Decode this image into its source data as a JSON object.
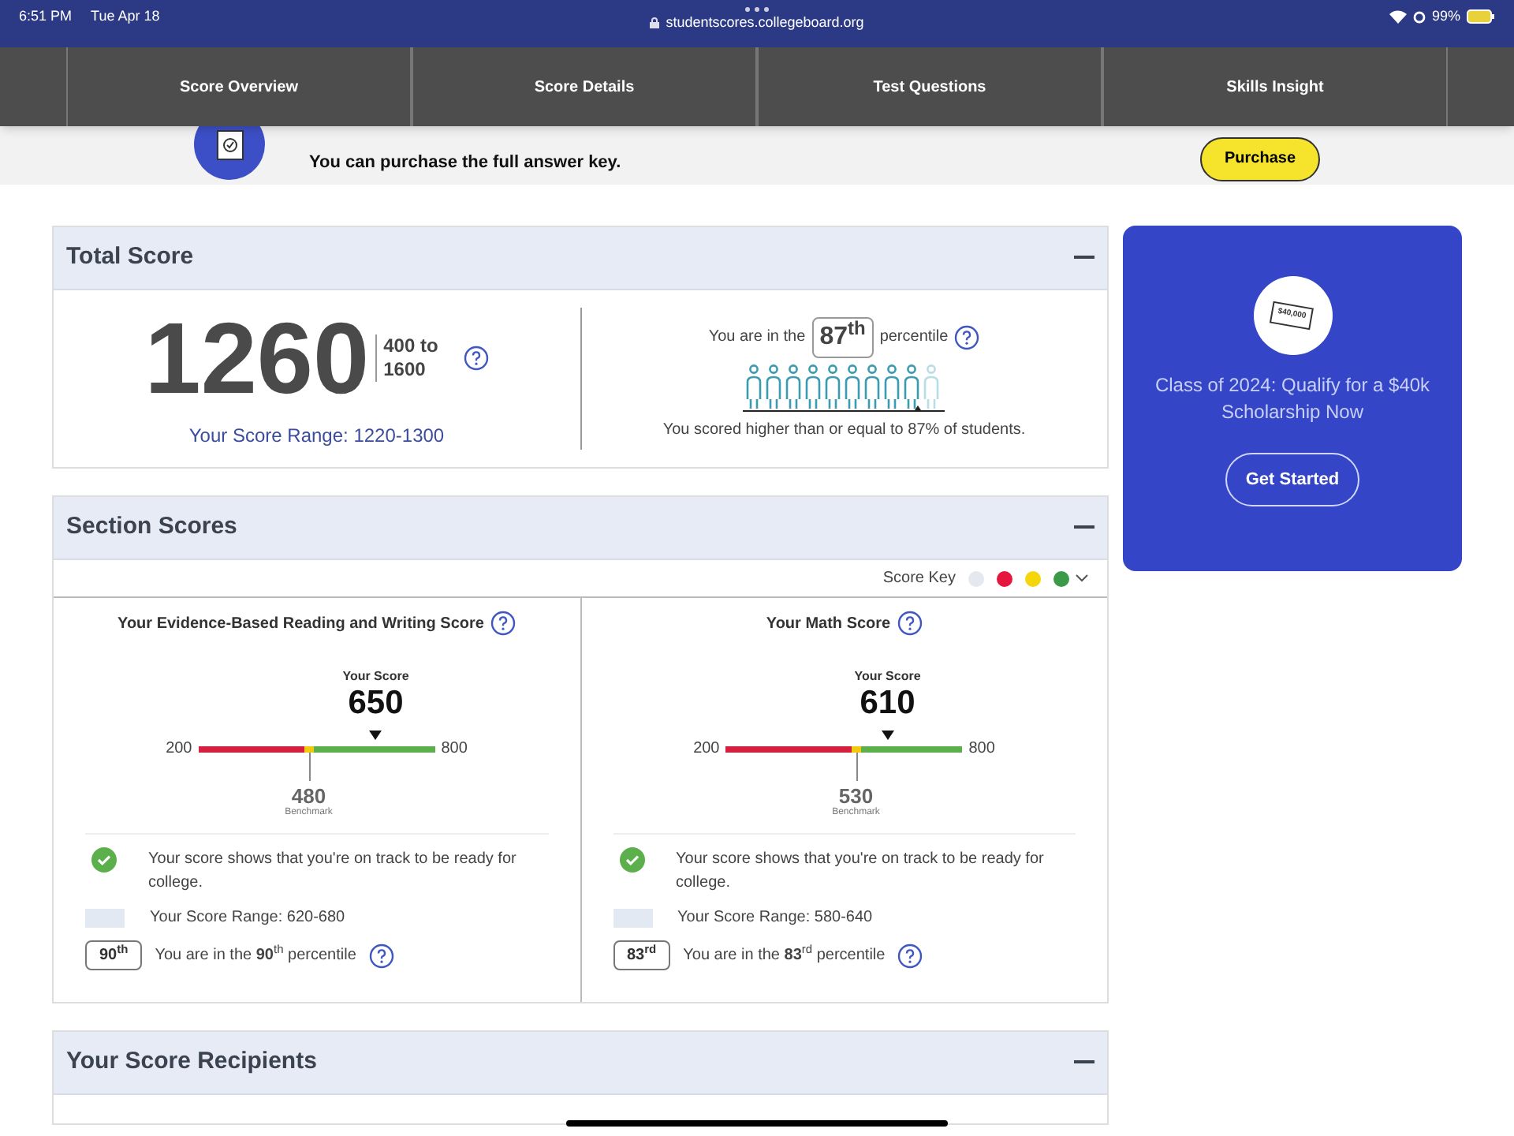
{
  "status_bar": {
    "time": "6:51 PM",
    "date": "Tue Apr 18",
    "url": "studentscores.collegeboard.org",
    "battery": "99%"
  },
  "tabs": [
    {
      "label": "Score Overview"
    },
    {
      "label": "Score Details"
    },
    {
      "label": "Test Questions"
    },
    {
      "label": "Skills Insight"
    }
  ],
  "banner": {
    "text": "You can purchase the full answer key.",
    "button": "Purchase"
  },
  "total_score": {
    "title": "Total Score",
    "score": "1260",
    "scale_from": "400 to",
    "scale_to": "1600",
    "range": "Your Score Range: 1220-1300",
    "percentile_prefix": "You are in the",
    "percentile": "87$^{th}$",
    "percentile_suffix": "percentile",
    "summary": "You scored higher than or equal to 87% of students."
  },
  "section_scores": {
    "title": "Section Scores",
    "score_key": "Score Key",
    "key_colors": [
      {
        "color": "#e3e9ee"
      },
      {
        "color": "#e5173f"
      },
      {
        "color": "#f5d60a"
      },
      {
        "color": "#3a9a47"
      }
    ],
    "sections": [
      {
        "title": "Your Evidence-Based Reading and Writing Score",
        "score_label": "Your Score",
        "score": "650",
        "min": "200",
        "max": "800",
        "benchmark": {
          "value": "480",
          "label": "Benchmark"
        },
        "message": "Your score shows that you're on track to be ready for college.",
        "range": "Your Score Range: 620-680",
        "percentile_badge": "90$^{th}$",
        "percentile_text": "You are in the **90**$^{th}$ percentile"
      },
      {
        "title": "Your Math Score",
        "score_label": "Your Score",
        "score": "610",
        "min": "200",
        "max": "800",
        "benchmark": {
          "value": "530",
          "label": "Benchmark"
        },
        "message": "Your score shows that you're on track to be ready for college.",
        "range": "Your Score Range: 580-640",
        "percentile_badge": "83$^{rd}$",
        "percentile_text": "You are in the **83**$^{rd}$ percentile"
      }
    ]
  },
  "recipients": {
    "title": "Your Score Recipients"
  },
  "promo": {
    "ticket": "$40,000",
    "text": "Class of 2024: Qualify for a $40k Scholarship Now",
    "button": "Get Started"
  }
}
